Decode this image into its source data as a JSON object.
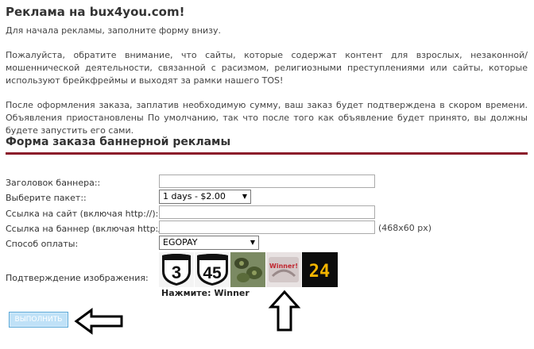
{
  "header": {
    "title": "Реклама на bux4you.com!"
  },
  "intro": {
    "p1": "Для начала рекламы, заполните форму внизу.",
    "p2": "Пожалуйста, обратите внимание, что сайты, которые содержат контент для взрослых, незаконной/мошеннической деятельности, связанной с расизмом, религиозными преступлениями или сайты, которые используют брейкфреймы и выходят за рамки нашего TOS!",
    "p3": "После оформления заказа, заплатив необходимую сумму, ваш заказ будет подтверждена в скором времени. Объявления приостановлены По умолчанию, так что после того как объявление будет принято, вы должны будете запустить его сами."
  },
  "form": {
    "title": "Форма заказа баннерной рекламы",
    "banner_title_label": "Заголовок баннера::",
    "banner_title_value": "",
    "package_label": "Выберите пакет::",
    "package_value": "1 days - $2.00",
    "site_url_label": "Ссылка на сайт (включая http://)::",
    "site_url_value": "",
    "banner_url_label": "Ссылка на баннер (включая http://)::",
    "banner_url_value": "",
    "banner_size_hint": "(468x60 px)",
    "payment_label": "Способ оплаты:",
    "payment_value": "EGOPAY",
    "captcha_label": "Подтверждение изображения:",
    "captcha_images": [
      "3",
      "45",
      "turtles",
      "Winner!",
      "24"
    ],
    "captcha_hint": "Нажмите: Winner",
    "submit_label": "ВЫПОЛНИТЬ"
  },
  "colors": {
    "rule": "#8b1a2a",
    "submit_bg": "#bfe1f7",
    "submit_border": "#5aa8d8"
  },
  "icons": {
    "submit_pointer": "arrow-left-icon",
    "captcha_pointer": "arrow-up-icon"
  }
}
